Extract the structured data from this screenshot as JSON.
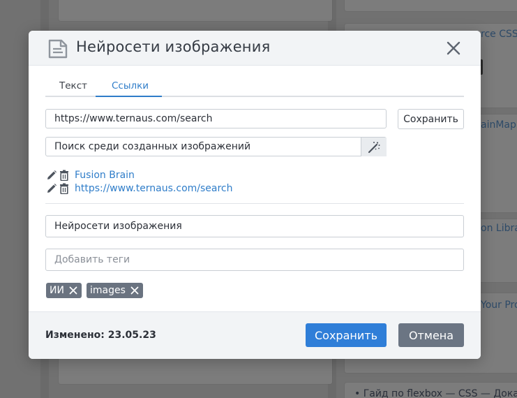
{
  "background": {
    "snippets": [
      {
        "id": "css",
        "text": "rce CSS"
      },
      {
        "id": "brainmap",
        "text": "ainMap"
      },
      {
        "id": "library",
        "text": "on Libra"
      },
      {
        "id": "yourpro",
        "text": "Your Pro"
      },
      {
        "id": "flexbox",
        "text": "• Гайд по flexbox — CSS — Дока"
      }
    ]
  },
  "modal": {
    "title": "Нейросети изображения",
    "icons": {
      "document": "document-icon",
      "close": "close-icon"
    },
    "tabs": [
      {
        "label": "Текст",
        "active": false
      },
      {
        "label": "Ссылки",
        "active": true
      }
    ],
    "link_form": {
      "url_value": "https://www.ternaus.com/search",
      "save_label": "Сохранить",
      "description_value": "Поиск среди созданных изображений",
      "magic_icon": "magic-wand-icon"
    },
    "links": [
      {
        "label": "Fusion Brain",
        "edit_icon": "pencil-icon",
        "delete_icon": "trash-icon"
      },
      {
        "label": "https://www.ternaus.com/search",
        "edit_icon": "pencil-icon",
        "delete_icon": "trash-icon"
      }
    ],
    "name_value": "Нейросети изображения",
    "tags_placeholder": "Добавить теги",
    "tags": [
      {
        "label": "ИИ"
      },
      {
        "label": "images"
      }
    ],
    "footer": {
      "modified": "Изменено: 23.05.23",
      "save_label": "Сохранить",
      "cancel_label": "Отмена"
    },
    "colors": {
      "accent": "#2f7ed8",
      "link": "#2f7dc9",
      "tag_bg": "#6a7380",
      "cancel_bg": "#6b7583",
      "header_bg": "#f2f4f6"
    }
  }
}
